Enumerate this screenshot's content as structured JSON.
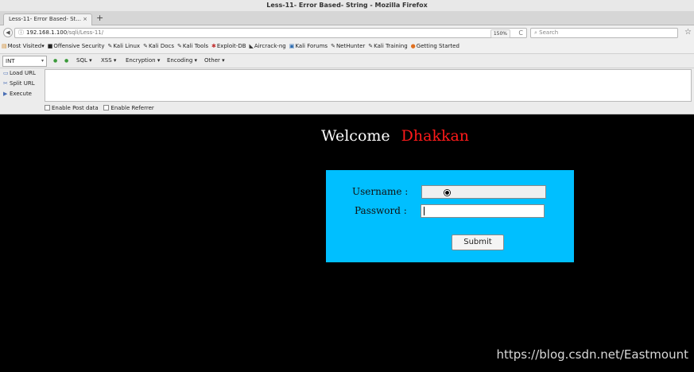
{
  "window": {
    "title": "Less-11- Error Based- String - Mozilla Firefox"
  },
  "tabs": [
    {
      "label": "Less-11- Error Based- St...",
      "close": "×"
    }
  ],
  "newtab": "+",
  "nav": {
    "back": "◀",
    "info": "ⓘ",
    "url_host": "192.168.1.100",
    "url_path": "/sqli/Less-11/",
    "zoom": "150%",
    "reload": "C",
    "search_placeholder": "Search",
    "star": "☆"
  },
  "bookmarks": [
    {
      "label": "Most Visited",
      "icon": "folder-icon",
      "glyph": "▤",
      "color": "#d08a2a"
    },
    {
      "label": "Offensive Security",
      "icon": "offsec-icon",
      "glyph": "■",
      "color": "#222222"
    },
    {
      "label": "Kali Linux",
      "icon": "kali-icon",
      "glyph": "✎",
      "color": "#333333"
    },
    {
      "label": "Kali Docs",
      "icon": "kali-icon",
      "glyph": "✎",
      "color": "#333333"
    },
    {
      "label": "Kali Tools",
      "icon": "kali-icon",
      "glyph": "✎",
      "color": "#333333"
    },
    {
      "label": "Exploit-DB",
      "icon": "exploitdb-icon",
      "glyph": "✱",
      "color": "#c03030"
    },
    {
      "label": "Aircrack-ng",
      "icon": "aircrack-icon",
      "glyph": "◣",
      "color": "#333333"
    },
    {
      "label": "Kali Forums",
      "icon": "forums-icon",
      "glyph": "▣",
      "color": "#2a6ab0"
    },
    {
      "label": "NetHunter",
      "icon": "kali-icon",
      "glyph": "✎",
      "color": "#333333"
    },
    {
      "label": "Kali Training",
      "icon": "kali-icon",
      "glyph": "✎",
      "color": "#333333"
    },
    {
      "label": "Getting Started",
      "icon": "firefox-icon",
      "glyph": "●",
      "color": "#e07020"
    }
  ],
  "hackbar": {
    "select_value": "INT",
    "select_arrow": "▾",
    "icon_glyph": "●",
    "menus": [
      "SQL",
      "XSS",
      "Encryption",
      "Encoding",
      "Other"
    ],
    "actions": [
      {
        "label": "Load URL",
        "glyph": "▭"
      },
      {
        "label": "Split URL",
        "glyph": "✂"
      },
      {
        "label": "Execute",
        "glyph": "▶"
      }
    ],
    "options": [
      "Enable Post data",
      "Enable Referrer"
    ]
  },
  "page": {
    "welcome": "Welcome",
    "name": "Dhakkan",
    "username_label": "Username :",
    "password_label": "Password :",
    "username_value": "",
    "password_value": "",
    "submit": "Submit",
    "accent": "#00bfff",
    "name_color": "#ff1a1a"
  },
  "watermark": "https://blog.csdn.net/Eastmount"
}
